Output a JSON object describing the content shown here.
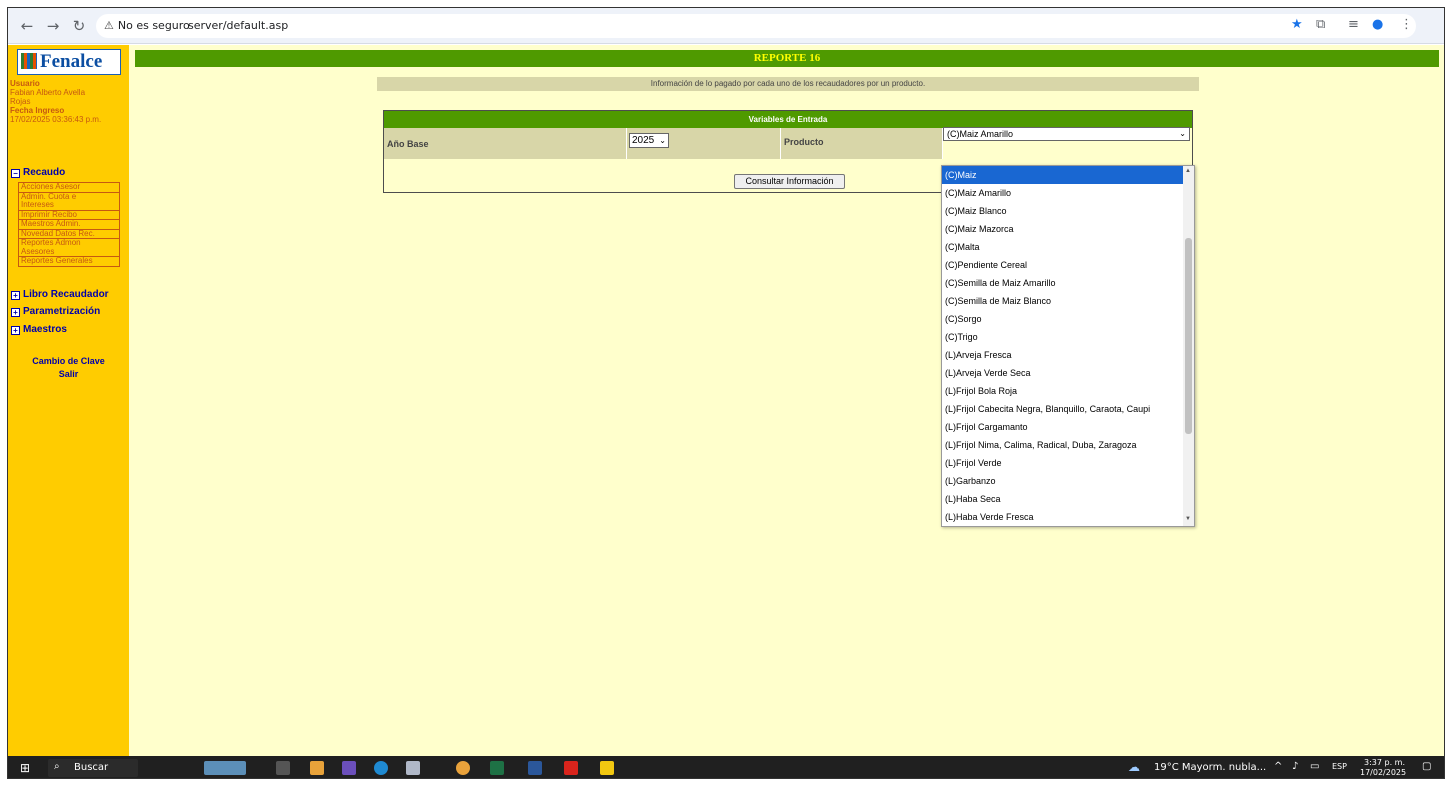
{
  "browser": {
    "security_label": "No es seguro",
    "url": "server/default.asp"
  },
  "sidebar": {
    "logo_text": "Fenalce",
    "user_label": "Usuario",
    "user_name_line1": "Fabian Alberto Avella",
    "user_name_line2": "Rojas",
    "login_label": "Fecha Ingreso",
    "login_date": "17/02/2025 03:36:43 p.m.",
    "section_recaudo": "Recaudo",
    "menu_items": [
      "Acciones Asesor",
      "Admin. Cuota e",
      "Intereses",
      "Imprimir Recibo",
      "Maestros Admin.",
      "Novedad Datos Rec.",
      "Reportes Admon",
      "Asesores",
      "Reportes Generales"
    ],
    "section_libro": "Libro Recaudador",
    "section_param": "Parametrización",
    "section_maestros": "Maestros",
    "link_clave": "Cambio de Clave",
    "link_salir": "Salir"
  },
  "content": {
    "title": "REPORTE 16",
    "info": "Información de lo pagado por cada uno de los recaudadores por un producto.",
    "form_header": "Variables de Entrada",
    "year_label": "Año Base",
    "year_value": "2025",
    "product_label": "Producto",
    "product_value": "(C)Maiz Amarillo",
    "consult_button": "Consultar Información"
  },
  "dropdown": {
    "selected_index": 0,
    "options": [
      "(C)Maiz",
      "(C)Maiz Amarillo",
      "(C)Maiz Blanco",
      "(C)Maiz Mazorca",
      "(C)Malta",
      "(C)Pendiente Cereal",
      "(C)Semilla de Maiz Amarillo",
      "(C)Semilla de Maiz Blanco",
      "(C)Sorgo",
      "(C)Trigo",
      "(L)Arveja Fresca",
      "(L)Arveja Verde Seca",
      "(L)Frijol Bola Roja",
      "(L)Frijol Cabecita Negra, Blanquillo, Caraota, Caupi",
      "(L)Frijol Cargamanto",
      "(L)Frijol Nima, Calima, Radical, Duba, Zaragoza",
      "(L)Frijol Verde",
      "(L)Garbanzo",
      "(L)Haba Seca",
      "(L)Haba Verde Fresca"
    ]
  },
  "taskbar": {
    "search_label": "Buscar",
    "weather": "19°C Mayorm. nubla...",
    "lang": "ESP",
    "time": "3:37 p. m.",
    "date": "17/02/2025"
  },
  "colors": {
    "sidebar": "#ffcc00",
    "page_bg": "#ffffcc",
    "title_bar": "#4f9a00",
    "title_text": "#ffff00",
    "selected": "#1967d2"
  }
}
